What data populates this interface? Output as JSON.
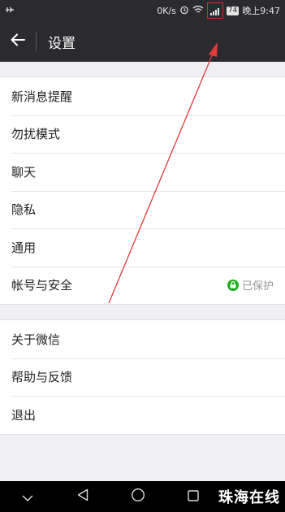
{
  "statusbar": {
    "speed": "0K/s",
    "battery": "74",
    "time": "晚上9:47",
    "icons": [
      "usb-icon",
      "alarm-icon",
      "wifi-icon",
      "signal-icon"
    ]
  },
  "header": {
    "title": "设置",
    "back_icon": "arrow-left-icon"
  },
  "settings": {
    "group1": [
      {
        "label": "新消息提醒"
      },
      {
        "label": "勿扰模式"
      },
      {
        "label": "聊天"
      },
      {
        "label": "隐私"
      },
      {
        "label": "通用"
      },
      {
        "label": "帐号与安全",
        "status": "已保护"
      }
    ],
    "group2": [
      {
        "label": "关于微信"
      },
      {
        "label": "帮助与反馈"
      },
      {
        "label": "退出"
      }
    ]
  },
  "navbar": {
    "icons": [
      "chevron-down-icon",
      "back-triangle-icon",
      "home-circle-icon",
      "recent-square-icon"
    ]
  },
  "watermark": "珠海在线",
  "colors": {
    "header_bg": "#2b2b2f",
    "page_bg": "#efeff4",
    "accent_green": "#1aad19",
    "annotation_red": "#d03030"
  }
}
